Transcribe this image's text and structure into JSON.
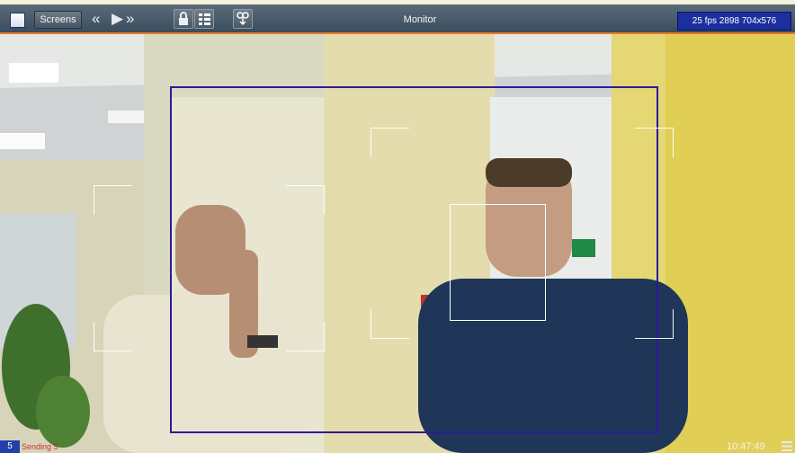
{
  "toolbar": {
    "screens_label": "Screens",
    "title": "Monitor",
    "stats": "25 fps 2898 704x576",
    "icons": [
      "checkbox-icon",
      "rewind-icon",
      "play-icon",
      "fast-forward-icon",
      "lock-icon",
      "list-icon",
      "download-icon"
    ]
  },
  "status": {
    "camera_number": "5",
    "recording_text": "Sending 5",
    "time": "10:47:49"
  },
  "colors": {
    "accent_line": "#e87a2a",
    "overlay_box": "#2d1a9a",
    "stats_bg": "#1b2f9e",
    "camera_badge": "#2140a8"
  }
}
